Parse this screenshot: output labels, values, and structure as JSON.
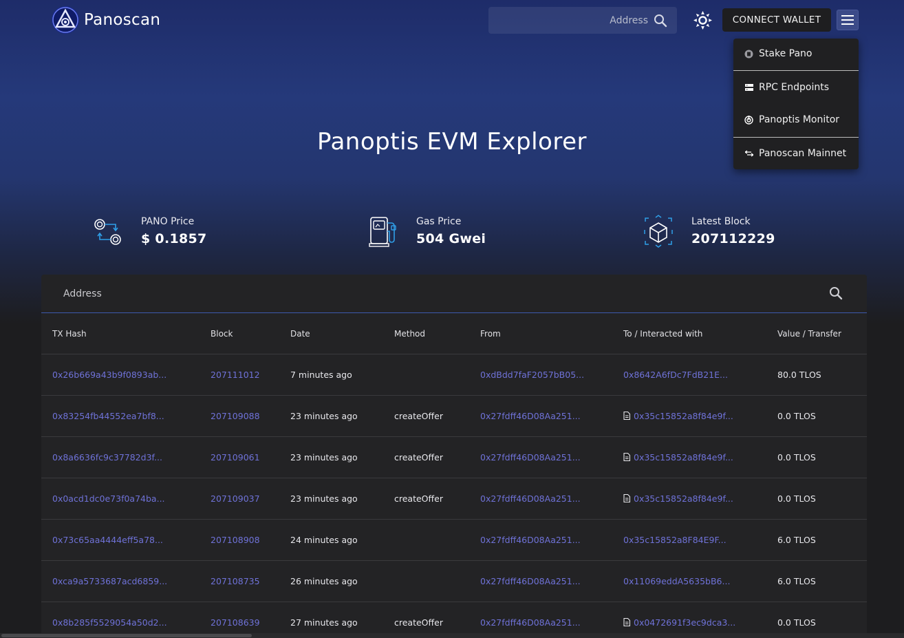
{
  "header": {
    "brand": "Panoscan",
    "search_placeholder": "Address",
    "connect_label": "CONNECT WALLET"
  },
  "menu": {
    "items": [
      {
        "label": "Stake Pano",
        "icon": "pano-coin-icon"
      },
      {
        "label": "RPC Endpoints",
        "icon": "server-icon"
      },
      {
        "label": "Panoptis Monitor",
        "icon": "monitor-icon"
      },
      {
        "label": "Panoscan Mainnet",
        "icon": "swap-icon"
      }
    ]
  },
  "hero": {
    "title": "Panoptis EVM Explorer"
  },
  "stats": {
    "price": {
      "label": "PANO Price",
      "value": "$ 0.1857"
    },
    "gas": {
      "label": "Gas Price",
      "value": "504 Gwei"
    },
    "block": {
      "label": "Latest Block",
      "value": "207112229"
    }
  },
  "table": {
    "search_placeholder": "Address",
    "columns": [
      "TX Hash",
      "Block",
      "Date",
      "Method",
      "From",
      "To / Interacted with",
      "Value / Transfer"
    ],
    "rows": [
      {
        "hash": "0x26b669a43b9f0893ab...",
        "block": "207111012",
        "date": "7 minutes ago",
        "method": "",
        "from": "0xdBdd7faF2057bB05...",
        "to": "0x8642A6fDc7FdB21E...",
        "to_contract": false,
        "value": "80.0 TLOS"
      },
      {
        "hash": "0x83254fb44552ea7bf8...",
        "block": "207109088",
        "date": "23 minutes ago",
        "method": "createOffer",
        "from": "0x27fdff46D08Aa251...",
        "to": "0x35c15852a8f84e9f...",
        "to_contract": true,
        "value": "0.0 TLOS"
      },
      {
        "hash": "0x8a6636fc9c37782d3f...",
        "block": "207109061",
        "date": "23 minutes ago",
        "method": "createOffer",
        "from": "0x27fdff46D08Aa251...",
        "to": "0x35c15852a8f84e9f...",
        "to_contract": true,
        "value": "0.0 TLOS"
      },
      {
        "hash": "0x0acd1dc0e73f0a74ba...",
        "block": "207109037",
        "date": "23 minutes ago",
        "method": "createOffer",
        "from": "0x27fdff46D08Aa251...",
        "to": "0x35c15852a8f84e9f...",
        "to_contract": true,
        "value": "0.0 TLOS"
      },
      {
        "hash": "0x73c65aa4444eff5a78...",
        "block": "207108908",
        "date": "24 minutes ago",
        "method": "",
        "from": "0x27fdff46D08Aa251...",
        "to": "0x35c15852a8F84E9F...",
        "to_contract": false,
        "value": "6.0 TLOS"
      },
      {
        "hash": "0xca9a5733687acd6859...",
        "block": "207108735",
        "date": "26 minutes ago",
        "method": "",
        "from": "0x27fdff46D08Aa251...",
        "to": "0x11069eddA5635bB6...",
        "to_contract": false,
        "value": "6.0 TLOS"
      },
      {
        "hash": "0x8b285f5529054a50d2...",
        "block": "207108639",
        "date": "27 minutes ago",
        "method": "createOffer",
        "from": "0x27fdff46D08Aa251...",
        "to": "0x0472691f3ec9dca3...",
        "to_contract": true,
        "value": "0.0 TLOS"
      }
    ]
  },
  "colors": {
    "link": "#6f72d8",
    "accent_blue": "#3d5ab0",
    "icon_blue": "#2f9fe8",
    "hero_top": "#1e2c69",
    "page_bg": "#1d1d1f"
  }
}
